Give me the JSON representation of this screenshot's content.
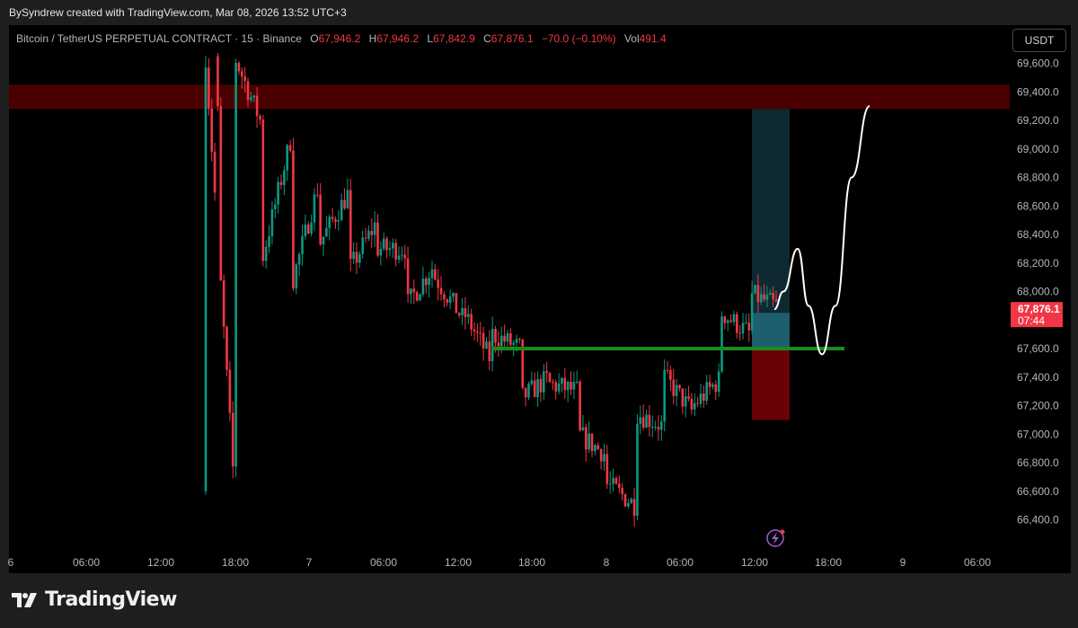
{
  "header": {
    "attribution": "BySyndrew created with TradingView.com, Mar 08, 2026 13:52 UTC+3"
  },
  "legend": {
    "symbol": "Bitcoin / TetherUS PERPETUAL CONTRACT · 15 · Binance",
    "o_label": "O",
    "o_value": "67,946.2",
    "h_label": "H",
    "h_value": "67,946.2",
    "l_label": "L",
    "l_value": "67,842.9",
    "c_label": "C",
    "c_value": "67,876.1",
    "change": "−70.0 (−0.10%)",
    "vol_label": "Vol",
    "vol_value": "491.4"
  },
  "currency_button": "USDT",
  "brand": {
    "name": "TradingView"
  },
  "colors": {
    "up": "#089981",
    "down": "#f23645",
    "price_tag": "#f23645",
    "zone": "#4a0000",
    "support": "#1b8a1b"
  },
  "chart_data": {
    "type": "candlestick",
    "symbol": "BTCUSDT.P",
    "interval": "15",
    "y_axis": {
      "ticks": [
        "69,600.0",
        "69,400.0",
        "69,200.0",
        "69,000.0",
        "68,800.0",
        "68,600.0",
        "68,400.0",
        "68,200.0",
        "68,000.0",
        "67,800.0",
        "67,600.0",
        "67,400.0",
        "67,200.0",
        "67,000.0",
        "66,800.0",
        "66,600.0",
        "66,400.0"
      ],
      "ylim": [
        66300,
        69800
      ]
    },
    "x_axis": {
      "ticks": [
        "6",
        "06:00",
        "12:00",
        "18:00",
        "7",
        "06:00",
        "12:00",
        "18:00",
        "8",
        "06:00",
        "12:00",
        "18:00",
        "9",
        "06:00"
      ]
    },
    "current_price": {
      "price": "67,876.1",
      "countdown": "07:44"
    },
    "resistance_zone": [
      69280,
      69450
    ],
    "support_line": 67600,
    "long_position": {
      "entry": 67600,
      "target": 69280,
      "stop": 67100
    },
    "price_path": [
      [
        69650,
        66600
      ],
      [
        69650,
        69150
      ],
      [
        68250,
        69100
      ],
      [
        68050,
        68800
      ],
      [
        68350,
        68700
      ],
      [
        68150,
        68500
      ],
      [
        68300,
        68300
      ],
      [
        67900,
        68200
      ],
      [
        68100,
        67800
      ],
      [
        67850,
        67500
      ],
      [
        67700,
        67600
      ],
      [
        67250,
        67400
      ],
      [
        67350,
        67300
      ],
      [
        67000,
        66850
      ],
      [
        66650,
        66500
      ],
      [
        67150,
        67050
      ],
      [
        67400,
        67150
      ],
      [
        67200,
        67400
      ],
      [
        67850,
        67700
      ],
      [
        67980,
        67890
      ]
    ],
    "projection": [
      67876,
      68000,
      68300,
      67900,
      67560,
      67900,
      68800,
      69300
    ]
  }
}
